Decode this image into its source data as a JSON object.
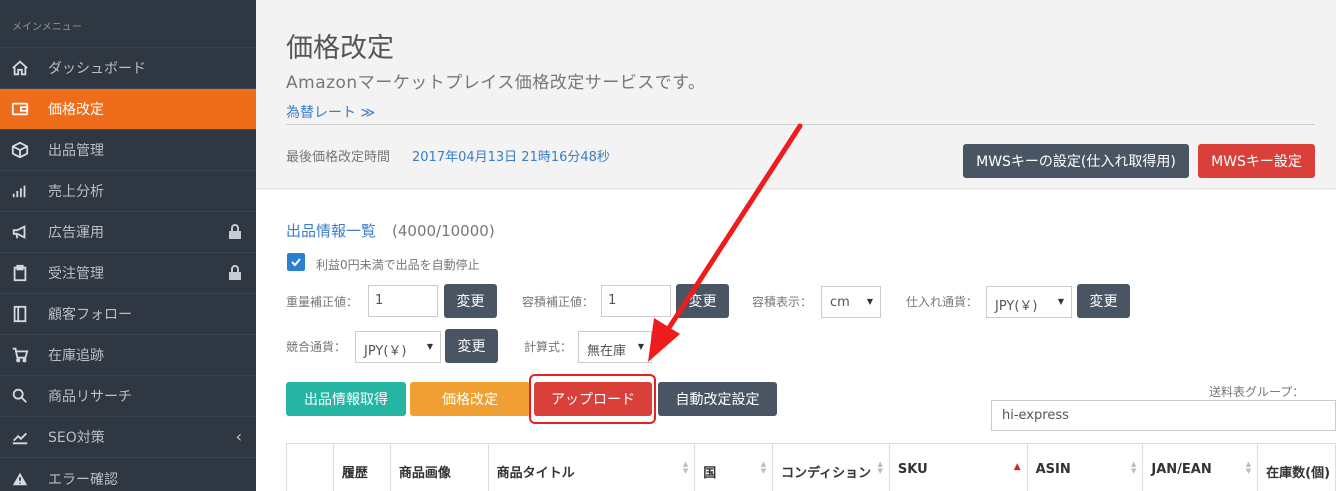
{
  "sidebar": {
    "header": "メインメニュー",
    "items": [
      {
        "label": "ダッシュボード",
        "icon": "home-icon"
      },
      {
        "label": "価格改定",
        "icon": "wallet-icon",
        "active": true
      },
      {
        "label": "出品管理",
        "icon": "box-icon"
      },
      {
        "label": "売上分析",
        "icon": "bar-chart-icon"
      },
      {
        "label": "広告運用",
        "icon": "megaphone-icon",
        "locked": true
      },
      {
        "label": "受注管理",
        "icon": "clipboard-icon",
        "locked": true
      },
      {
        "label": "顧客フォロー",
        "icon": "book-icon"
      },
      {
        "label": "在庫追跡",
        "icon": "cart-icon"
      },
      {
        "label": "商品リサーチ",
        "icon": "search-icon"
      },
      {
        "label": "SEO対策",
        "icon": "line-chart-icon",
        "expandable": true
      },
      {
        "label": "エラー確認",
        "icon": "warning-icon"
      }
    ]
  },
  "header": {
    "title": "価格改定",
    "subtitle": "Amazonマーケットプレイス価格改定サービスです。",
    "rate_link": "為替レート ≫",
    "last_time_label": "最後価格改定時間",
    "last_time_value": "2017年04月13日 21時16分48秒",
    "mws_purchase_btn": "MWSキーの設定(仕入れ取得用)",
    "mws_btn": "MWSキー設定"
  },
  "listing": {
    "title": "出品情報一覧",
    "count": "(4000/10000)",
    "auto_stop_label": "利益0円未満で出品を自動停止",
    "weight_label": "重量補正値：",
    "weight_value": "1",
    "volume_label": "容積補正値：",
    "volume_value": "1",
    "volume_display_label": "容積表示：",
    "volume_display_value": "cm",
    "purchase_currency_label": "仕入れ通貨：",
    "purchase_currency_value": "JPY(￥)",
    "competitor_currency_label": "競合通貨：",
    "competitor_currency_value": "JPY(￥)",
    "formula_label": "計算式：",
    "formula_value": "無在庫",
    "change_label": "変更",
    "shipping_group_label": "送料表グループ：",
    "shipping_group_value": "hi-express"
  },
  "actions": {
    "fetch": "出品情報取得",
    "reprice": "価格改定",
    "upload": "アップロード",
    "auto_settings": "自動改定設定"
  },
  "table": {
    "columns": [
      "",
      "履歴",
      "商品画像",
      "商品タイトル",
      "国",
      "コンディション",
      "SKU",
      "ASIN",
      "JAN/EAN",
      "在庫数(個)"
    ]
  },
  "colors": {
    "sidebar_bg": "#2f3742",
    "active": "#ef6c1a",
    "teal": "#26b5a2",
    "orange": "#f0a033",
    "red": "#d9403a",
    "dark": "#4a5563",
    "link": "#3a7ec5"
  }
}
